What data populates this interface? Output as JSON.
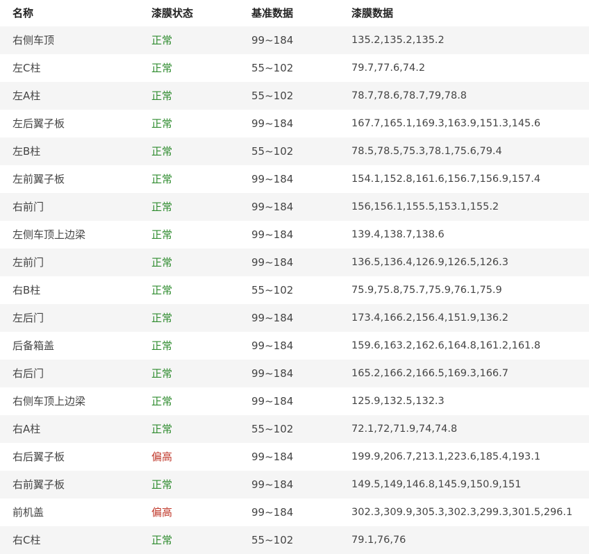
{
  "header": {
    "name": "名称",
    "status": "漆膜状态",
    "reference": "基准数据",
    "data": "漆膜数据"
  },
  "colors": {
    "normal": "#2e8b2e",
    "high": "#c0392b",
    "stripe": "#f5f5f5"
  },
  "rows": [
    {
      "name": "右侧车顶",
      "status": "正常",
      "level": "normal",
      "reference": "99~184",
      "data": "135.2,135.2,135.2"
    },
    {
      "name": "左C柱",
      "status": "正常",
      "level": "normal",
      "reference": "55~102",
      "data": "79.7,77.6,74.2"
    },
    {
      "name": "左A柱",
      "status": "正常",
      "level": "normal",
      "reference": "55~102",
      "data": "78.7,78.6,78.7,79,78.8"
    },
    {
      "name": "左后翼子板",
      "status": "正常",
      "level": "normal",
      "reference": "99~184",
      "data": "167.7,165.1,169.3,163.9,151.3,145.6"
    },
    {
      "name": "左B柱",
      "status": "正常",
      "level": "normal",
      "reference": "55~102",
      "data": "78.5,78.5,75.3,78.1,75.6,79.4"
    },
    {
      "name": "左前翼子板",
      "status": "正常",
      "level": "normal",
      "reference": "99~184",
      "data": "154.1,152.8,161.6,156.7,156.9,157.4"
    },
    {
      "name": "右前门",
      "status": "正常",
      "level": "normal",
      "reference": "99~184",
      "data": "156,156.1,155.5,153.1,155.2"
    },
    {
      "name": "左侧车顶上边梁",
      "status": "正常",
      "level": "normal",
      "reference": "99~184",
      "data": "139.4,138.7,138.6"
    },
    {
      "name": "左前门",
      "status": "正常",
      "level": "normal",
      "reference": "99~184",
      "data": "136.5,136.4,126.9,126.5,126.3"
    },
    {
      "name": "右B柱",
      "status": "正常",
      "level": "normal",
      "reference": "55~102",
      "data": "75.9,75.8,75.7,75.9,76.1,75.9"
    },
    {
      "name": "左后门",
      "status": "正常",
      "level": "normal",
      "reference": "99~184",
      "data": "173.4,166.2,156.4,151.9,136.2"
    },
    {
      "name": "后备箱盖",
      "status": "正常",
      "level": "normal",
      "reference": "99~184",
      "data": "159.6,163.2,162.6,164.8,161.2,161.8"
    },
    {
      "name": "右后门",
      "status": "正常",
      "level": "normal",
      "reference": "99~184",
      "data": "165.2,166.2,166.5,169.3,166.7"
    },
    {
      "name": "右侧车顶上边梁",
      "status": "正常",
      "level": "normal",
      "reference": "99~184",
      "data": "125.9,132.5,132.3"
    },
    {
      "name": "右A柱",
      "status": "正常",
      "level": "normal",
      "reference": "55~102",
      "data": "72.1,72,71.9,74,74.8"
    },
    {
      "name": "右后翼子板",
      "status": "偏高",
      "level": "high",
      "reference": "99~184",
      "data": "199.9,206.7,213.1,223.6,185.4,193.1"
    },
    {
      "name": "右前翼子板",
      "status": "正常",
      "level": "normal",
      "reference": "99~184",
      "data": "149.5,149,146.8,145.9,150.9,151"
    },
    {
      "name": "前机盖",
      "status": "偏高",
      "level": "high",
      "reference": "99~184",
      "data": "302.3,309.9,305.3,302.3,299.3,301.5,296.1"
    },
    {
      "name": "右C柱",
      "status": "正常",
      "level": "normal",
      "reference": "55~102",
      "data": "79.1,76,76"
    }
  ]
}
